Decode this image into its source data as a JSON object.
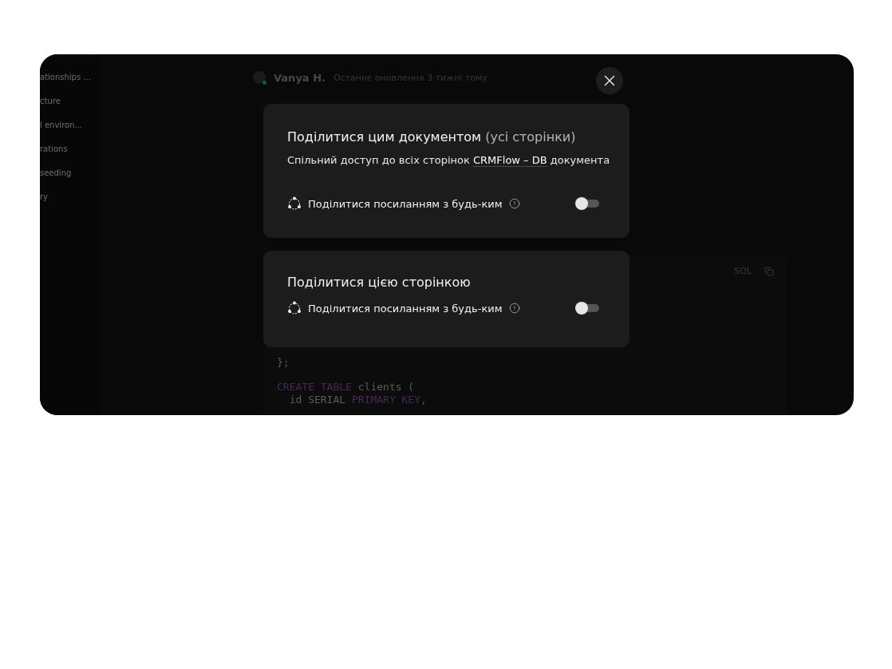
{
  "background": {
    "sidebar_items": [
      "ationships ...",
      "cture",
      "l environ...",
      "rations",
      "seeding",
      "ry"
    ],
    "author": "Vanya H.",
    "updated": "Останнє оновлення 3 тижні тому",
    "code_language": "SQL",
    "code_lines": [
      [
        {
          "kind": "plain",
          "text": "};"
        }
      ],
      [
        {
          "kind": "keyword",
          "text": "CREATE TABLE"
        },
        {
          "kind": "plain",
          "text": " clients ("
        }
      ],
      [
        {
          "kind": "plain",
          "text": "  id SERIAL "
        },
        {
          "kind": "keyword",
          "text": "PRIMARY KEY"
        },
        {
          "kind": "plain",
          "text": ","
        }
      ]
    ]
  },
  "dialog": {
    "sections": [
      {
        "title": "Поділитися цим документом",
        "title_note": "(усі сторінки)",
        "description": {
          "before": "Спільний доступ до всіх сторінок",
          "link": "CRMFlow – DB",
          "after": "документа"
        },
        "option": {
          "label": "Поділитися посиланням з будь-ким",
          "on": false
        }
      },
      {
        "title": "Поділитися цією сторінкою",
        "option": {
          "label": "Поділитися посиланням з будь-ким",
          "on": false
        }
      }
    ]
  }
}
